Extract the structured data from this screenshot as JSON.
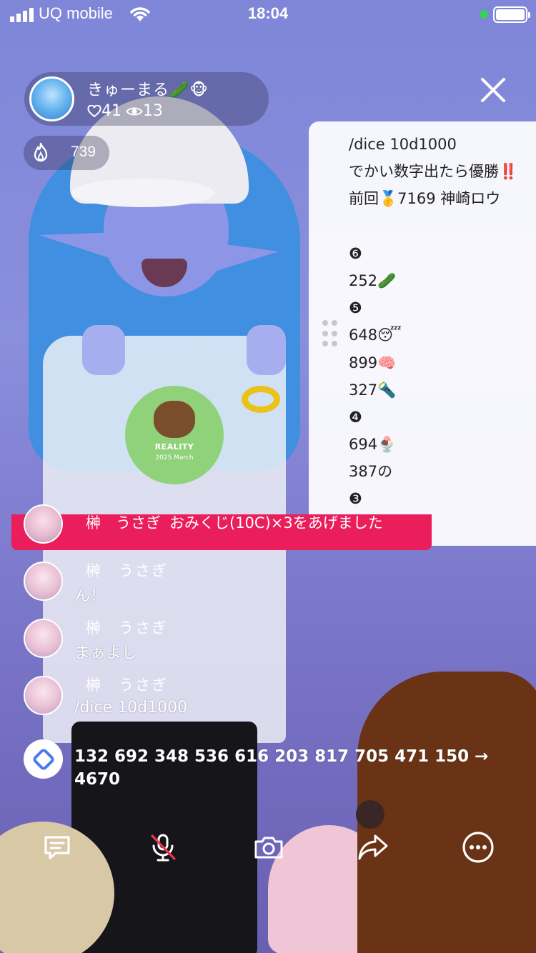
{
  "status_bar": {
    "carrier": "UQ mobile",
    "time": "18:04"
  },
  "host": {
    "name": "きゅーまる🥒🐵",
    "hearts": "41",
    "viewers": "13"
  },
  "gift_counter": "739",
  "panel": {
    "lines": [
      "/dice 10d1000",
      "でかい数字出たら優勝‼️",
      "前回🥇7169 神崎ロウ",
      "",
      "❻",
      "252🥒",
      "❺",
      "648😴",
      "899🧠",
      "327🔦",
      "❹",
      "694🍨",
      "387の",
      "❸"
    ]
  },
  "gift_banner": {
    "user": "榊　うさぎ",
    "message": "おみくじ(10C)×3をあげました"
  },
  "chat": [
    {
      "name": "榊　うさぎ",
      "message": "ん！"
    },
    {
      "name": "榊　うさぎ",
      "message": "まぁよし"
    },
    {
      "name": "榊　うさぎ",
      "message": "/dice 10d1000"
    }
  ],
  "dice_result": "132 692 348 536 616 203 817 705 471 150 → 4670",
  "toolbar": {
    "items": [
      "comment-icon",
      "mic-muted-icon",
      "camera-icon",
      "share-icon",
      "more-icon"
    ]
  },
  "colors": {
    "gift_banner": "#e91e5a",
    "status_online": "#35d158"
  }
}
